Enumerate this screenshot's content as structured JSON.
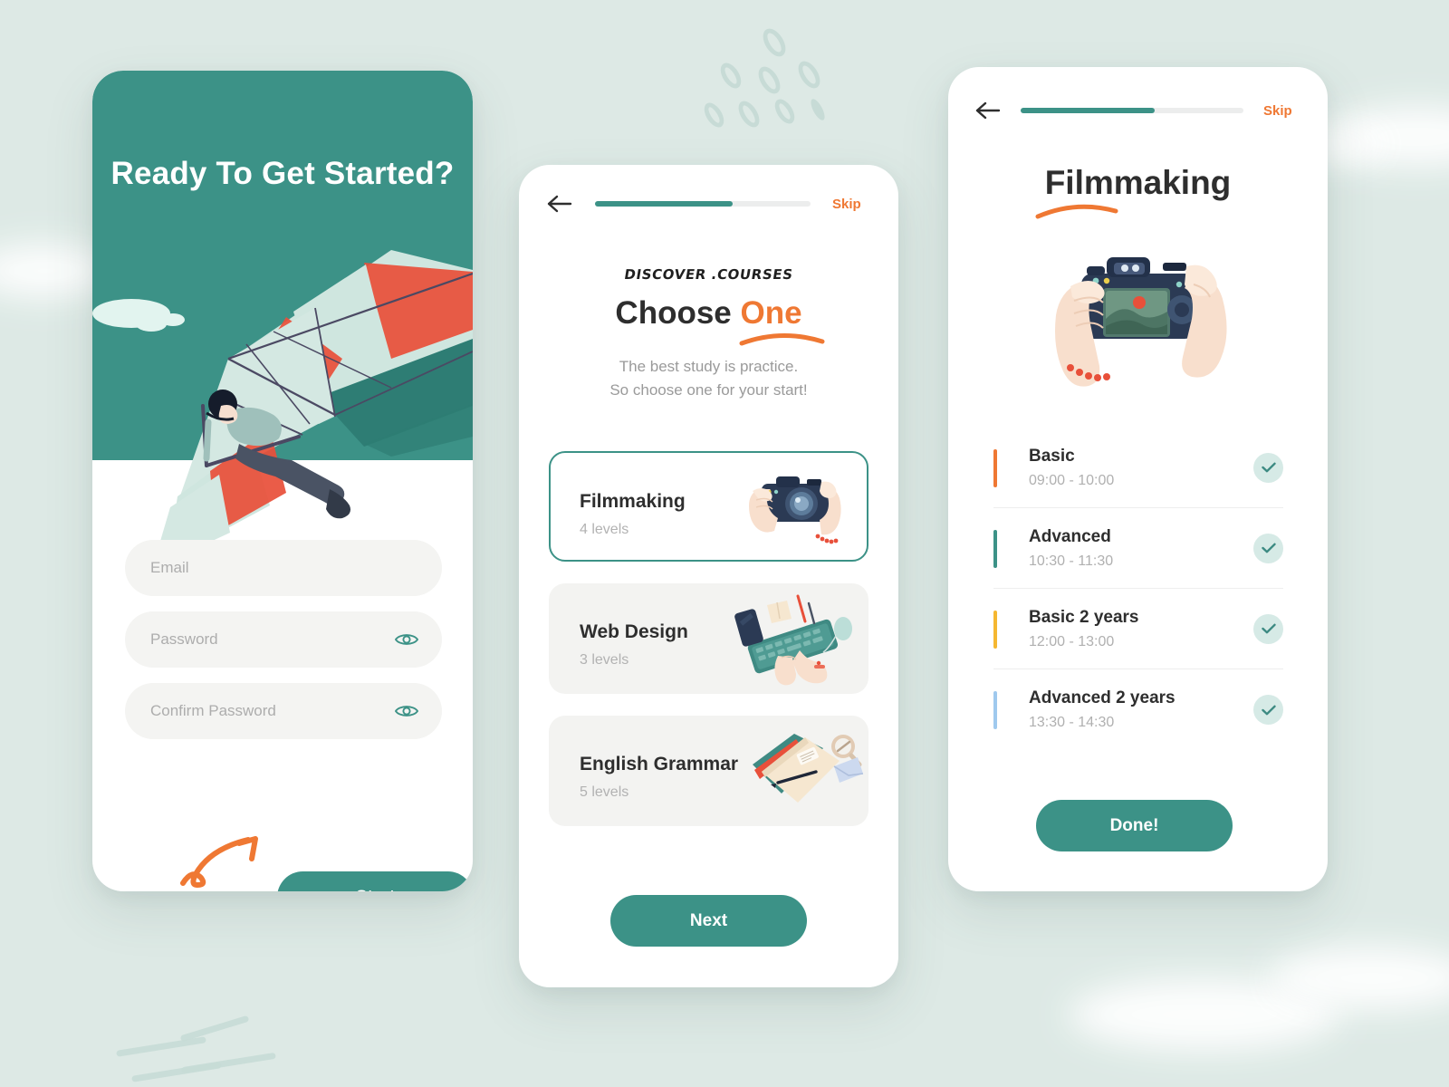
{
  "theme": {
    "page_bg": "#dde9e5",
    "brand_teal": "#3c9287",
    "accent_orange": "#ef7833",
    "text_dark": "#2e2e2e",
    "text_muted": "#b0b0b0",
    "field_bg": "#f4f4f2",
    "badge_bg": "#d6eae6"
  },
  "phone1": {
    "hero_title": "Ready To Get Started?",
    "hero_illustration": "hang-glider-illustration",
    "fields": [
      {
        "name": "email",
        "placeholder": "Email",
        "value": "",
        "has_eye": false
      },
      {
        "name": "password",
        "placeholder": "Password",
        "value": "",
        "has_eye": true
      },
      {
        "name": "confirm-password",
        "placeholder": "Confirm Password",
        "value": "",
        "has_eye": true
      }
    ],
    "eye_icon": "eye-icon",
    "arrow_doodle": "curved-arrow-doodle",
    "start_label": "Start"
  },
  "phone2": {
    "back_icon": "arrow-left-icon",
    "progress_percent": 64,
    "skip_label": "Skip",
    "kicker": "DISCOVER .COURSES",
    "headline_lead": "Choose ",
    "headline_accent": "One",
    "subtitle_line1": "The best study is practice.",
    "subtitle_line2": "So choose one for your start!",
    "courses": [
      {
        "name": "Filmmaking",
        "levels": "4 levels",
        "selected": true,
        "art": "camera-in-hands-illustration"
      },
      {
        "name": "Web Design",
        "levels": "3 levels",
        "selected": false,
        "art": "keyboard-desk-illustration"
      },
      {
        "name": "English Grammar",
        "levels": "5 levels",
        "selected": false,
        "art": "notebooks-illustration"
      }
    ],
    "next_label": "Next"
  },
  "phone3": {
    "back_icon": "arrow-left-icon",
    "progress_percent": 60,
    "skip_label": "Skip",
    "title": "Filmmaking",
    "illustration": "camera-in-hands-illustration",
    "schedule": [
      {
        "title": "Basic",
        "time": "09:00 - 10:00",
        "bar_color": "#ef7833",
        "checked": true
      },
      {
        "title": "Advanced",
        "time": "10:30 - 11:30",
        "bar_color": "#3c9287",
        "checked": true
      },
      {
        "title": "Basic 2 years",
        "time": "12:00 - 13:00",
        "bar_color": "#f5b731",
        "checked": true
      },
      {
        "title": "Advanced 2 years",
        "time": "13:30 - 14:30",
        "bar_color": "#9fc9ee",
        "checked": true
      }
    ],
    "check_icon": "check-icon",
    "done_label": "Done!"
  }
}
